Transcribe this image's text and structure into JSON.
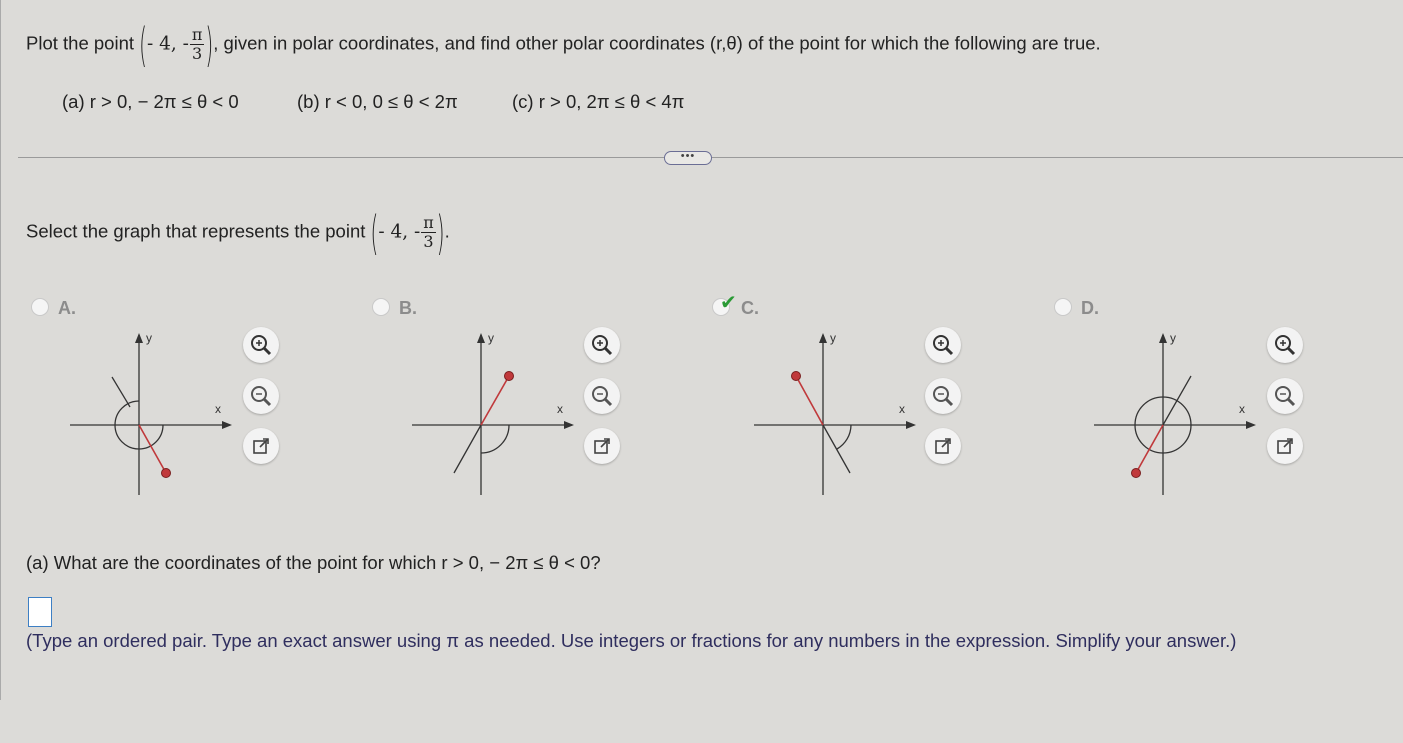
{
  "question": {
    "prefix": "Plot the point",
    "point_r": "- 4, -",
    "point_num": "π",
    "point_den": "3",
    "suffix": ", given in polar coordinates, and find other polar coordinates (r,θ) of the point for which the following are true."
  },
  "conditions": {
    "a": "(a) r > 0,  − 2π ≤ θ < 0",
    "b": "(b) r < 0, 0 ≤ θ < 2π",
    "c": "(c) r > 0, 2π ≤ θ < 4π"
  },
  "expand_label": "•••",
  "select": {
    "prefix": "Select the graph that represents the point",
    "point_r": "- 4, -",
    "point_num": "π",
    "point_den": "3",
    "period": "."
  },
  "options": [
    {
      "label": "A.",
      "selected": false,
      "axis_x": "x",
      "axis_y": "y"
    },
    {
      "label": "B.",
      "selected": false,
      "axis_x": "x",
      "axis_y": "y"
    },
    {
      "label": "C.",
      "selected": true,
      "axis_x": "x",
      "axis_y": "y"
    },
    {
      "label": "D.",
      "selected": false,
      "axis_x": "x",
      "axis_y": "y"
    }
  ],
  "check_mark": "✔",
  "part_a": {
    "question": "(a) What are the coordinates of the point for which r > 0,  − 2π ≤ θ < 0?",
    "answer_value": "",
    "hint": "(Type an ordered pair. Type an exact answer using π as needed. Use integers or fractions for any numbers in the expression. Simplify your answer.)"
  },
  "colors": {
    "point_fill": "#c0393b",
    "ray": "#c0393b",
    "check": "#2a9a35",
    "hint_text": "#2f2e5e",
    "answer_border": "#3d7fc4"
  },
  "icons": [
    "zoom-in-icon",
    "zoom-out-icon",
    "popout-icon",
    "check-icon"
  ]
}
